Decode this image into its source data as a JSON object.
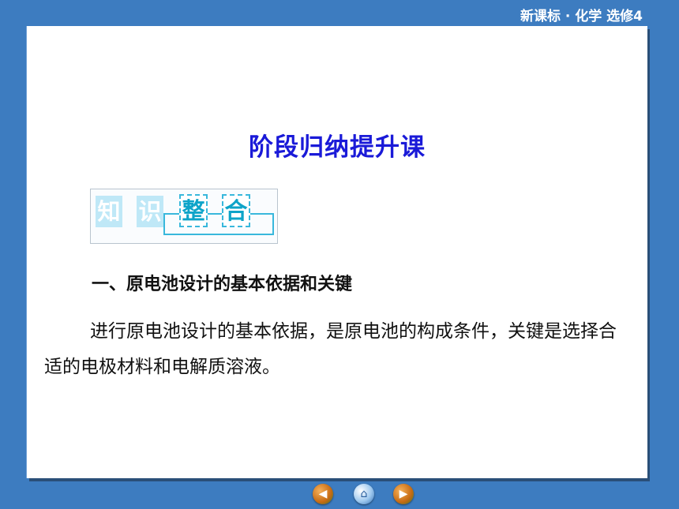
{
  "header": {
    "title": "新课标 · 化学  选修4"
  },
  "slide": {
    "title": "阶段归纳提升课",
    "banner": {
      "chars": [
        "知",
        "识",
        "整",
        "合"
      ]
    },
    "section_heading": "一、原电池设计的基本依据和关键",
    "paragraph": "进行原电池设计的基本依据，是原电池的构成条件，关键是选择合适的电极材料和电解质溶液。"
  },
  "nav": {
    "prev_icon": "arrow-left-icon",
    "home_icon": "home-icon",
    "next_icon": "arrow-right-icon"
  }
}
